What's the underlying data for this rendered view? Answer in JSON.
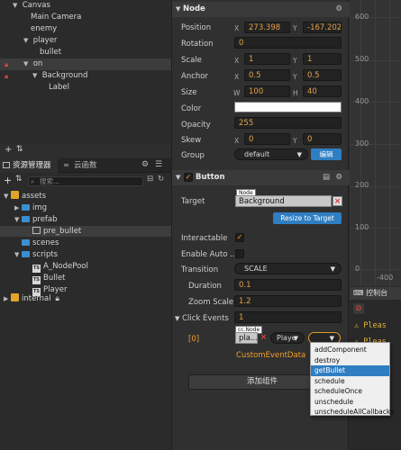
{
  "hierarchy": {
    "rows": [
      {
        "label": "Canvas",
        "arrow": "▼"
      },
      {
        "label": "Main Camera",
        "arrow": ""
      },
      {
        "label": "enemy",
        "arrow": ""
      },
      {
        "label": "player",
        "arrow": "▼"
      },
      {
        "label": "bullet",
        "arrow": ""
      },
      {
        "label": "on",
        "arrow": "▼"
      },
      {
        "label": "Background",
        "arrow": "▼"
      },
      {
        "label": "Label",
        "arrow": ""
      }
    ],
    "toolbar": {
      "add": "+",
      "sort": "⇅"
    }
  },
  "assets": {
    "tab_active": "资源管理器",
    "tab_inactive": "云函数",
    "search_placeholder": "搜索...",
    "rows": [
      {
        "label": "assets"
      },
      {
        "label": "img"
      },
      {
        "label": "prefab"
      },
      {
        "label": "pre_bullet"
      },
      {
        "label": "scenes"
      },
      {
        "label": "scripts"
      },
      {
        "label": "A_NodePool"
      },
      {
        "label": "Bullet"
      },
      {
        "label": "Player"
      },
      {
        "label": "internal"
      }
    ],
    "ts_badge": "TS"
  },
  "inspector": {
    "node": {
      "title": "Node",
      "position": {
        "label": "Position",
        "x": "273.398",
        "y": "-167.202"
      },
      "rotation": {
        "label": "Rotation",
        "value": "0"
      },
      "scale": {
        "label": "Scale",
        "x": "1",
        "y": "1"
      },
      "anchor": {
        "label": "Anchor",
        "x": "0.5",
        "y": "0.5"
      },
      "size": {
        "label": "Size",
        "w": "100",
        "h": "40"
      },
      "color": {
        "label": "Color"
      },
      "opacity": {
        "label": "Opacity",
        "value": "255"
      },
      "skew": {
        "label": "Skew",
        "x": "0",
        "y": "0"
      },
      "group": {
        "label": "Group",
        "value": "default",
        "edit": "编辑"
      },
      "axis_x": "X",
      "axis_y": "Y",
      "axis_w": "W",
      "axis_h": "H"
    },
    "button": {
      "title": "Button",
      "target_label": "Target",
      "target_tag": "Node",
      "target_value": "Background",
      "resize_btn": "Resize to Target",
      "interactable_label": "Interactable",
      "enable_auto_label": "Enable Auto ...",
      "transition_label": "Transition",
      "transition_value": "SCALE",
      "duration_label": "Duration",
      "duration_value": "0.1",
      "zoom_label": "Zoom Scale",
      "zoom_value": "1.2",
      "click_events_label": "Click Events",
      "click_events_value": "1",
      "event_index": "[0]",
      "event_tag": "cc.Node",
      "event_node": "pla...",
      "event_component": "Playe",
      "custom_data_label": "CustomEventData"
    },
    "add_component": "添加组件"
  },
  "scene": {
    "labels": [
      "600",
      "500",
      "400",
      "300",
      "200",
      "100",
      "0"
    ],
    "bottom_label": "-400"
  },
  "console": {
    "title": "控制台",
    "warnings": [
      "Pleas",
      "Pleas"
    ]
  },
  "popup": {
    "items": [
      "addComponent",
      "destroy",
      "getBullet",
      "schedule",
      "scheduleOnce",
      "unschedule",
      "unscheduleAllCallbacks"
    ],
    "selected": "getBullet"
  },
  "colors": {
    "accent_blue": "#2f7ec2",
    "value_orange": "#e3a14a",
    "label_orange": "#f19e2c",
    "warn_yellow": "#e8b33a"
  }
}
